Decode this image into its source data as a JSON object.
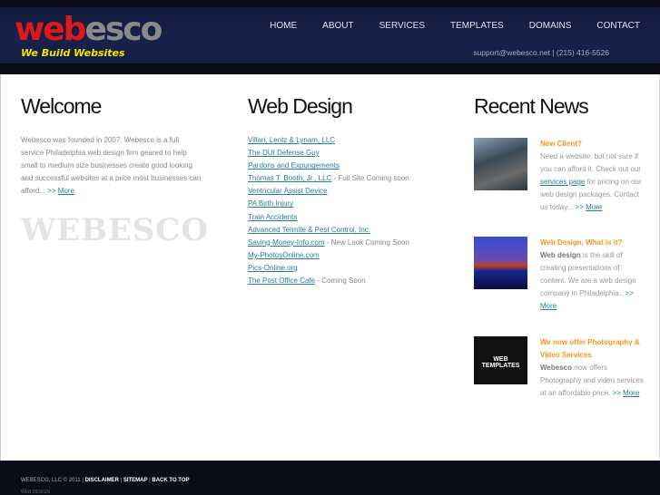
{
  "header": {
    "logo_red": "web",
    "logo_gray": "esco",
    "tagline": "We Build Websites",
    "nav": [
      "HOME",
      "ABOUT",
      "SERVICES",
      "TEMPLATES",
      "DOMAINS",
      "CONTACT"
    ],
    "contact": "support@webesco.net | (215) 416-5526"
  },
  "welcome": {
    "title": "Welcome",
    "text": "Webesco was founded in 2007. Webesco is a full service Philadelphia web design firm geared to help small to medium size businesses create good looking and successful websites at a price most businesses can afford... ",
    "more_prefix": ">>",
    "more": "More",
    "watermark": "WEBESCO"
  },
  "webdesign": {
    "title": "Web Design",
    "items": [
      {
        "link": "Villari, Lentz & Lynam, LLC",
        "note": ""
      },
      {
        "link": "The DUI Defense Guy",
        "note": ""
      },
      {
        "link": "Pardons and Expungements",
        "note": ""
      },
      {
        "link": "Thomas T. Booth, Jr., LLC",
        "note": " - Full Site Coming soon"
      },
      {
        "link": "Ventricular Assist Device",
        "note": ""
      },
      {
        "link": "PA Birth Injury",
        "note": ""
      },
      {
        "link": "Train Accidents",
        "note": ""
      },
      {
        "link": "Advanced Termite & Pest Control, Inc.",
        "note": ""
      },
      {
        "link": "Saving-Money-Info.com",
        "note": " - New Look Coming Soon"
      },
      {
        "link": "My-PhotosOnline.com",
        "note": ""
      },
      {
        "link": "Pics-Online.org",
        "note": ""
      },
      {
        "link": "The Post Office Cafe",
        "note": " - Coming Soon"
      }
    ]
  },
  "news": {
    "title": "Recent News",
    "items": [
      {
        "title": "New Client?",
        "a": "Need a website, but not sure if you can afford it. Check out our ",
        "link": "services page",
        "b": " for pricing on our web design packages. Contact us today... ",
        "more_prefix": ">>",
        "more": "More"
      },
      {
        "title": "Web Design, What is it?",
        "bold": "Web design",
        "b": " is the skill of creating presentations of content. We are a web design company in Philadelphia.. ",
        "more_prefix": ">>",
        "more": "More"
      },
      {
        "title": "We now offer Photography & Video Services",
        "bold": "Webesco",
        "b": " now offers Photography and video services at an affordable price. ",
        "more_prefix": ">>",
        "more": "More",
        "thumb_text": "WEB TEMPLATES"
      }
    ]
  },
  "footer": {
    "copyright": "WEBESCO, LLC © 2011 | ",
    "links": [
      "DISCLAIMER",
      "SITEMAP",
      "BACK TO TOP"
    ],
    "sub": "WEB DESIGN"
  }
}
